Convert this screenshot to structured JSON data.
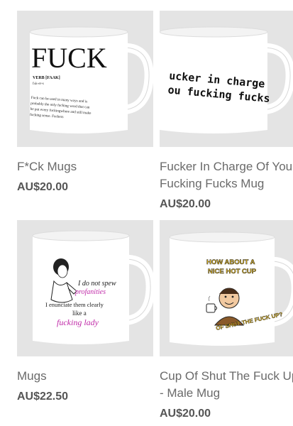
{
  "products": [
    {
      "name": "F*Ck Mugs",
      "price": "AU$20.00",
      "mug": {
        "headline": "FUCK",
        "part_of_speech": "VERB [FAAK]",
        "pronunciation": "fʌk-er-s",
        "definition_lines": [
          "Fuck can be used in many ways and is",
          "probably the only fucking word that can",
          "be put every fuckingwhere and still make",
          "fucking sense. Fuckers"
        ]
      }
    },
    {
      "name": "Fucker In Charge Of You Fucking Fucks Mug",
      "price": "AU$20.00",
      "mug": {
        "lines": [
          "ucker in charge",
          "ou fucking fucks"
        ]
      }
    },
    {
      "name": "Mugs",
      "price": "AU$22.50",
      "mug": {
        "lines": [
          "I do not spew",
          "profanities",
          "I enunciate them clearly",
          "like a",
          "fucking lady"
        ]
      }
    },
    {
      "name": "Cup Of Shut The Fuck Up - Male Mug",
      "price": "AU$20.00",
      "mug": {
        "top_lines": [
          "HOW ABOUT A",
          "NICE HOT CUP"
        ],
        "bottom_line": "OF SHUT THE FUCK UP?"
      }
    }
  ],
  "colors": {
    "tile_bg": "#e4e4e4",
    "price": "#555555",
    "name": "#6a6a6a",
    "accent_pink": "#c02aa8",
    "retro_yellow": "#f2c21b"
  }
}
